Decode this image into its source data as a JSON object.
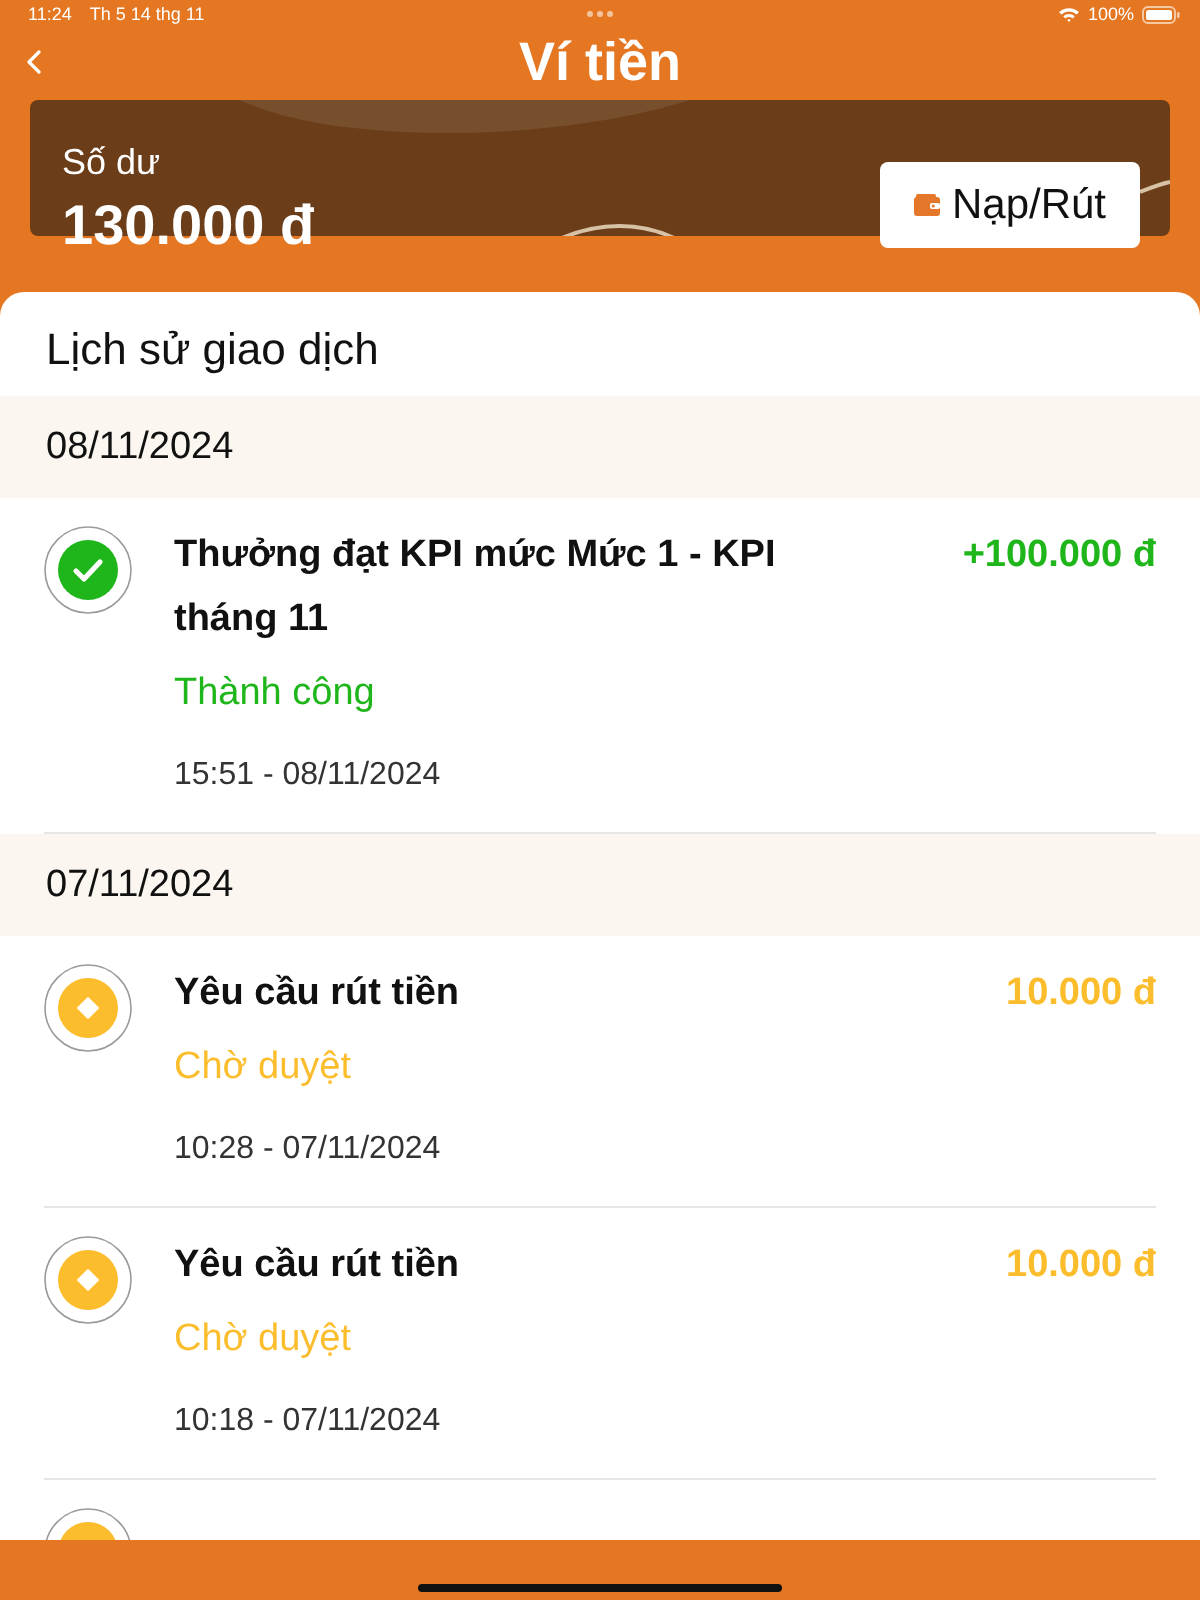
{
  "status_bar": {
    "time": "11:24",
    "date": "Th 5 14 thg 11",
    "battery": "100%"
  },
  "header": {
    "title": "Ví tiền"
  },
  "balance": {
    "label": "Số dư",
    "amount": "130.000 đ",
    "button": "Nạp/Rút"
  },
  "history": {
    "title": "Lịch sử giao dịch",
    "groups": [
      {
        "date": "08/11/2024",
        "transactions": [
          {
            "kind": "success",
            "title": "Thưởng đạt KPI mức Mức 1 - KPI tháng 11",
            "amount": "+100.000 đ",
            "status": "Thành công",
            "time": "15:51 - 08/11/2024"
          }
        ]
      },
      {
        "date": "07/11/2024",
        "transactions": [
          {
            "kind": "pending",
            "title": "Yêu cầu rút tiền",
            "amount": "10.000 đ",
            "status": "Chờ duyệt",
            "time": "10:28 - 07/11/2024"
          },
          {
            "kind": "pending",
            "title": "Yêu cầu rút tiền",
            "amount": "10.000 đ",
            "status": "Chờ duyệt",
            "time": "10:18 - 07/11/2024"
          },
          {
            "kind": "pending"
          }
        ]
      }
    ]
  }
}
